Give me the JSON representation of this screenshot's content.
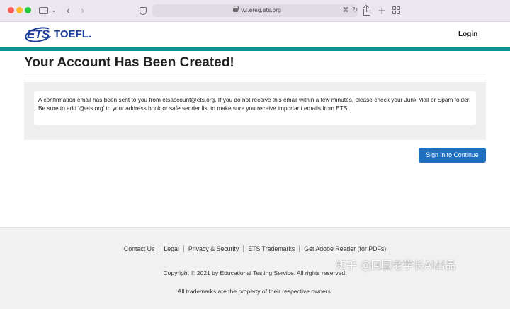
{
  "browser": {
    "url": "v2.ereg.ets.org",
    "icons": [
      "sidebar-icon",
      "chevron-down-icon",
      "back-arrow-icon",
      "forward-arrow-icon",
      "shield-icon",
      "lock-icon",
      "translate-icon",
      "reload-icon",
      "share-icon",
      "plus-icon",
      "tab-overview-icon"
    ]
  },
  "header": {
    "logo_primary": "ETS",
    "logo_secondary": "TOEFL.",
    "login_label": "Login"
  },
  "colors": {
    "brand_blue": "#1c3f94",
    "teal_bar": "#0a9393",
    "button_blue": "#1f6fbf"
  },
  "main": {
    "title": "Your Account Has Been Created!",
    "message": "A confirmation email has been sent to you from etsaccount@ets.org. If you do not receive this email within a few minutes, please check your Junk Mail or Spam folder. Be sure to add '@ets.org' to your address book or safe sender list to make sure you receive important emails from ETS.",
    "signin_label": "Sign in to Continue"
  },
  "footer": {
    "links": [
      "Contact Us",
      "Legal",
      "Privacy & Security",
      "ETS Trademarks",
      "Get Adobe Reader (for PDFs)"
    ],
    "copyright": "Copyright © 2021 by Educational Testing Service. All rights reserved.",
    "trademarks": "All trademarks are the property of their respective owners."
  },
  "watermark": "知乎 @回国老学长AI出品"
}
